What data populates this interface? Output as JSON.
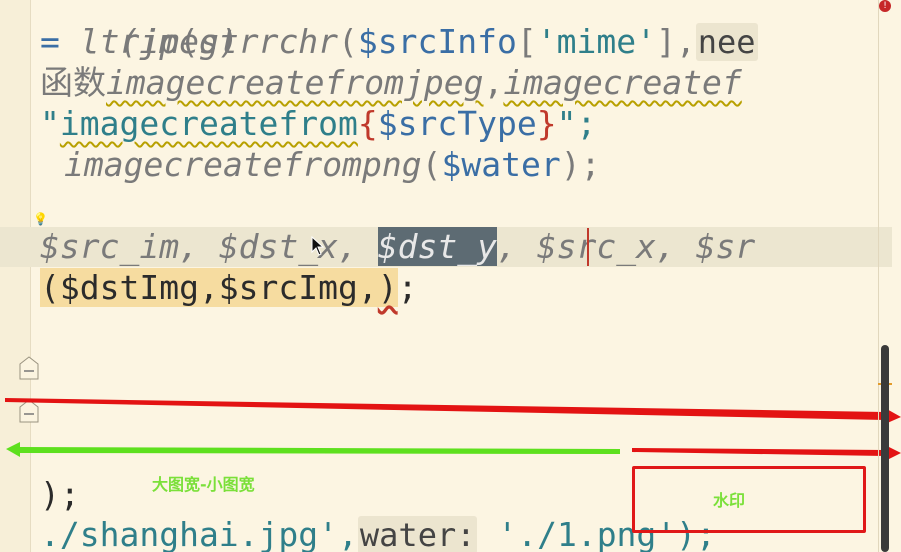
{
  "code": {
    "line1": "(jpeg)",
    "line2": {
      "eq": "= ",
      "fn1": "ltrim",
      "p1": "(",
      "fn2": "strrchr",
      "p2": "(",
      "var": "$srcInfo",
      "b1": "[",
      "str": "'mime'",
      "b2": "],",
      "hint": "nee"
    },
    "line3": {
      "prefix": "函数",
      "f1": "imagecreatefromjpeg",
      "comma": ",",
      "f2": "imagecreatef"
    },
    "line4": {
      "q1": "\"",
      "fn": "imagecreatefrom",
      "b1": "{",
      "var": "$srcType",
      "b2": "}",
      "q2": "\";"
    },
    "line5": {
      "fn": "imagecreatefrompng",
      "p1": "(",
      "var": "$water",
      "p2": ");"
    },
    "line6": {
      "a": "$src_im, ",
      "b": "$dst_x, ",
      "sel": "$dst_y",
      "c": ", $src_x, $sr"
    },
    "line7": {
      "a": "($dstImg,$srcImg,",
      "b": ")",
      "c": ";"
    },
    "line8": ");",
    "line9": {
      "a": "./shanghai.jpg',",
      "hint": "water:",
      "b": " './1.png');"
    }
  },
  "annotations": {
    "green_label": "大图宽-小图宽",
    "box_label": "水印"
  },
  "icons": {
    "warning": "error-icon",
    "bulb": "lightbulb-icon"
  },
  "colors": {
    "arrow_red": "#e31313",
    "arrow_green": "#5ee01e",
    "box_red": "#e01818"
  }
}
